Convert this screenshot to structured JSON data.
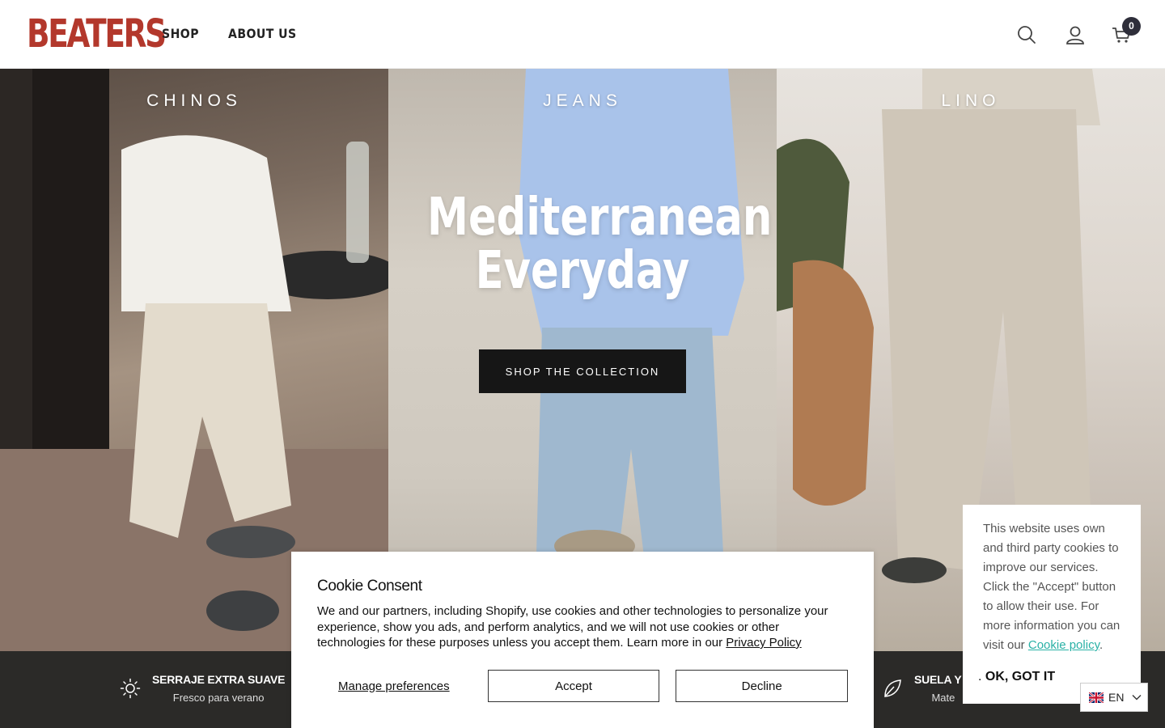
{
  "header": {
    "logo": "BEATERS",
    "nav": [
      "SHOP",
      "ABOUT US"
    ],
    "cart_count": "0",
    "icons": [
      "search-icon",
      "account-icon",
      "cart-icon"
    ]
  },
  "hero": {
    "panels": [
      "CHINOS",
      "JEANS",
      "LINO"
    ],
    "title_line1": "Mediterranean",
    "title_line2": "Everyday",
    "cta": "SHOP THE COLLECTION"
  },
  "features": [
    {
      "icon": "sun-icon",
      "title": "SERRAJE EXTRA SUAVE",
      "subtitle": "Fresco para verano"
    },
    {
      "icon": "leaf-icon",
      "title": "SUELA Y C",
      "subtitle": "Mate"
    }
  ],
  "cookie_consent": {
    "title": "Cookie Consent",
    "body": "We and our partners, including Shopify, use cookies and other technologies to personalize your experience, show you ads, and perform analytics, and we will not use cookies or other technologies for these purposes unless you accept them. Learn more in our ",
    "privacy_link": "Privacy Policy",
    "manage": "Manage preferences",
    "accept": "Accept",
    "decline": "Decline"
  },
  "cookie_notice": {
    "text": "This website uses own and third party cookies to improve our services. Click the \"Accept\" button to allow their use. For more information you can visit our ",
    "link": "Cookie policy",
    "after_link": ".",
    "ok_prefix": ". ",
    "ok": "OK, GOT IT"
  },
  "language": {
    "code": "EN"
  },
  "colors": {
    "brand": "#b3382c",
    "feature_bar": "#2b2a28",
    "cta": "#161616",
    "link_teal": "#2ab1a6"
  }
}
